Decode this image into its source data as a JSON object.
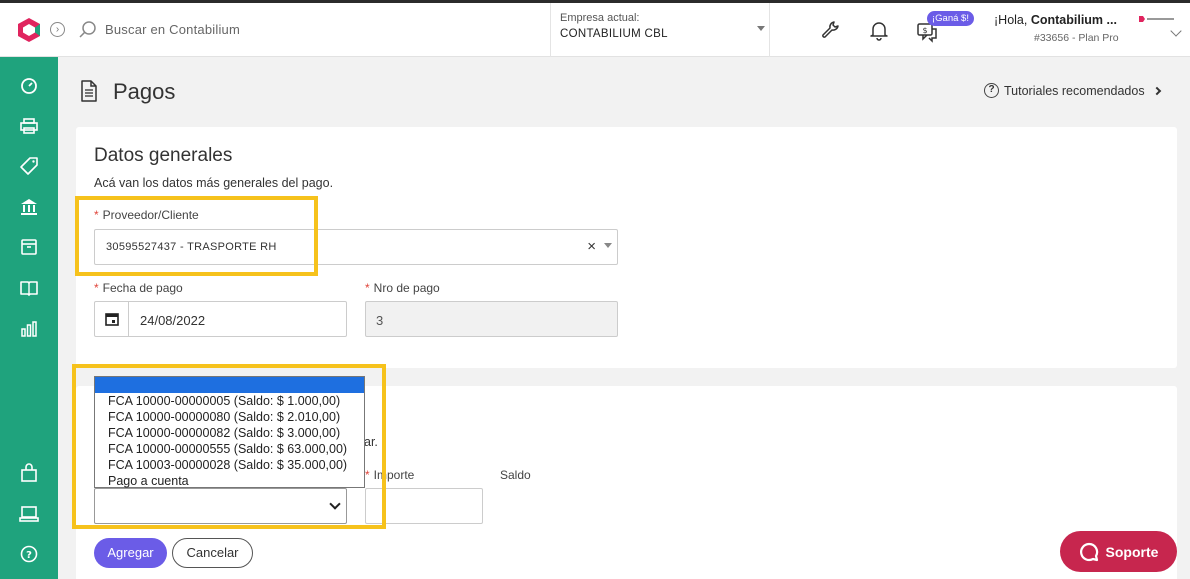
{
  "header": {
    "search_placeholder": "Buscar en Contabilium",
    "company_label": "Empresa actual:",
    "company_name": "CONTABILIUM CBL",
    "promo_badge": "¡Ganá $!",
    "greeting_prefix": "¡Hola, ",
    "greeting_name": "Contabilium ...",
    "plan_text": "#33656 - Plan Pro",
    "icons": [
      "wrench-icon",
      "bell-icon",
      "chat-money-icon"
    ]
  },
  "sidebar": {
    "items": [
      "dashboard-icon",
      "printer-icon",
      "tag-icon",
      "bank-icon",
      "archive-icon",
      "book-icon",
      "reports-icon",
      "shopping-bag-icon",
      "pos-icon",
      "help-icon"
    ]
  },
  "page": {
    "title": "Pagos",
    "tutorials_link": "Tutoriales recomendados"
  },
  "general": {
    "title": "Datos generales",
    "description": "Acá van los datos más generales del pago.",
    "provider_label": "Proveedor/Cliente",
    "provider_value": "30595527437 - TRASPORTE RH",
    "date_label": "Fecha de pago",
    "date_value": "24/08/2022",
    "nro_label": "Nro de pago",
    "nro_value": "3"
  },
  "comprobantes": {
    "partial_text": "ar.",
    "importe_label": "Importe",
    "saldo_label": "Saldo",
    "dropdown_options": [
      "FCA 10000-00000005 (Saldo: $ 1.000,00)",
      "FCA 10000-00000080 (Saldo: $ 2.010,00)",
      "FCA 10000-00000082 (Saldo: $ 3.000,00)",
      "FCA 10000-00000555 (Saldo: $ 63.000,00)",
      "FCA 10003-00000028 (Saldo: $ 35.000,00)",
      "Pago a cuenta"
    ],
    "add_button": "Agregar",
    "cancel_button": "Cancelar"
  },
  "support_button": "Soporte",
  "colors": {
    "sidebar": "#1fa37d",
    "primary": "#6b5ce7",
    "support": "#c7264e",
    "highlight": "#f6c21c",
    "required": "#e0453b"
  }
}
